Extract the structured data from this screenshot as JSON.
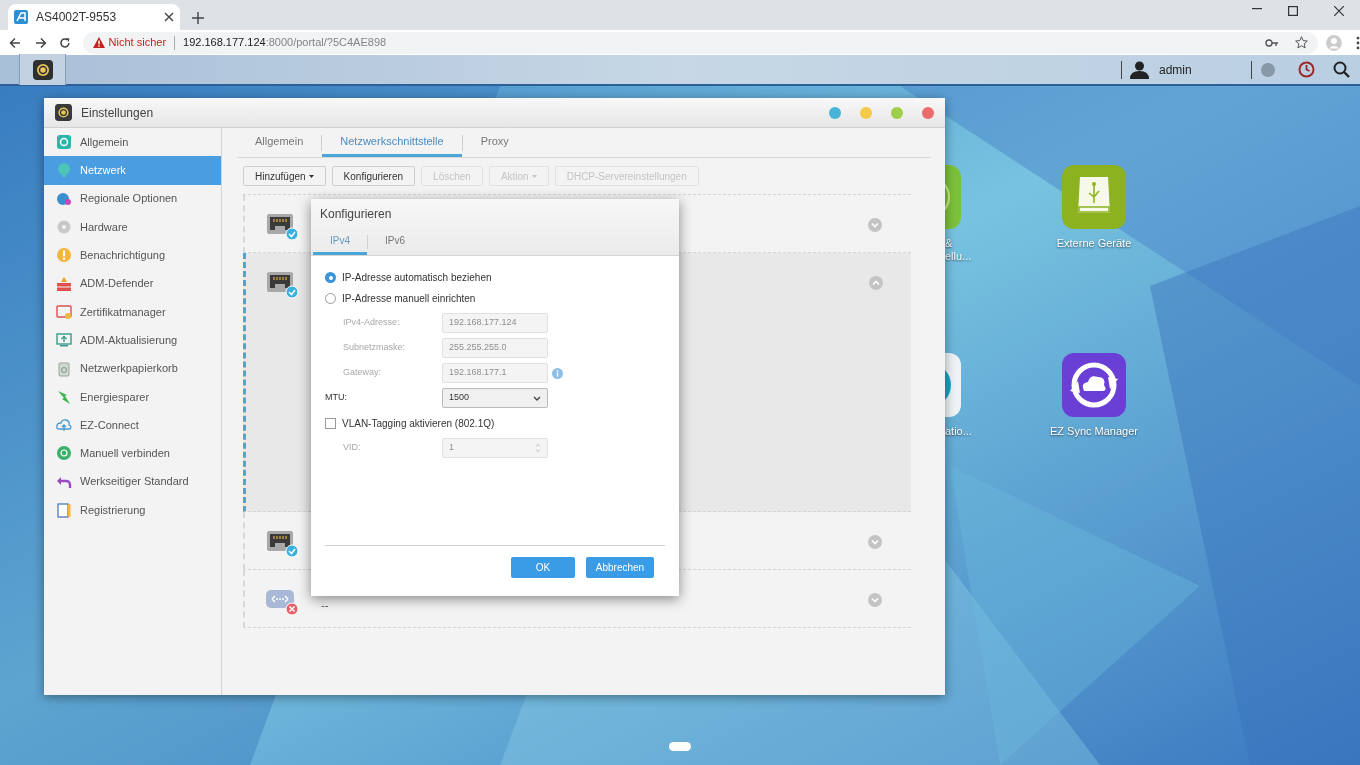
{
  "browser": {
    "tab_title": "AS4002T-9553",
    "security": "Nicht sicher",
    "url_host": "192.168.177.124",
    "url_rest": ":8000/portal/?5C4AE898"
  },
  "taskbar": {
    "user": "admin"
  },
  "desktop_icons": [
    {
      "kind": "cut-ring",
      "labels": [
        "&",
        "ellu..."
      ]
    },
    {
      "kind": "cut-disc",
      "labels": [
        "atio..."
      ]
    },
    {
      "kind": "usb-drive",
      "labels": [
        "Externe Geräte"
      ]
    },
    {
      "kind": "sync",
      "labels": [
        "EZ Sync Manager"
      ]
    }
  ],
  "window": {
    "title": "Einstellungen",
    "sidebar": [
      {
        "label": "Allgemein",
        "selected": false
      },
      {
        "label": "Netzwerk",
        "selected": true
      },
      {
        "label": "Regionale Optionen",
        "selected": false
      },
      {
        "label": "Hardware",
        "selected": false
      },
      {
        "label": "Benachrichtigung",
        "selected": false
      },
      {
        "label": "ADM-Defender",
        "selected": false
      },
      {
        "label": "Zertifikatmanager",
        "selected": false
      },
      {
        "label": "ADM-Aktualisierung",
        "selected": false
      },
      {
        "label": "Netzwerkpapierkorb",
        "selected": false
      },
      {
        "label": "Energiesparer",
        "selected": false
      },
      {
        "label": "EZ-Connect",
        "selected": false
      },
      {
        "label": "Manuell verbinden",
        "selected": false
      },
      {
        "label": "Werkseitiger Standard",
        "selected": false
      },
      {
        "label": "Registrierung",
        "selected": false
      }
    ],
    "tabs": [
      {
        "label": "Allgemein",
        "selected": false
      },
      {
        "label": "Netzwerkschnittstelle",
        "selected": true
      },
      {
        "label": "Proxy",
        "selected": false
      }
    ],
    "toolbar": [
      {
        "label": "Hinzufügen",
        "dropdown": true,
        "disabled": false
      },
      {
        "label": "Konfigurieren",
        "dropdown": false,
        "disabled": false
      },
      {
        "label": "Löschen",
        "dropdown": false,
        "disabled": true
      },
      {
        "label": "Aktion",
        "dropdown": true,
        "disabled": true
      },
      {
        "label": "DHCP-Servereinstellungen",
        "dropdown": false,
        "disabled": true
      }
    ],
    "interfaces": [
      {
        "kind": "ethernet",
        "connected": true,
        "expanded": false
      },
      {
        "kind": "ethernet",
        "connected": true,
        "expanded": true
      },
      {
        "kind": "ethernet",
        "connected": true,
        "expanded": false
      },
      {
        "kind": "virtual",
        "connected": false,
        "expanded": false,
        "name": "--"
      }
    ]
  },
  "dialog": {
    "title": "Konfigurieren",
    "tabs": [
      {
        "label": "IPv4",
        "selected": true
      },
      {
        "label": "IPv6",
        "selected": false
      }
    ],
    "options": [
      {
        "label": "IP-Adresse automatisch beziehen",
        "selected": true
      },
      {
        "label": "IP-Adresse manuell einrichten",
        "selected": false
      }
    ],
    "fields": [
      {
        "label": "IPv4-Adresse:",
        "value": "192.168.177.124",
        "disabled": true,
        "info": false
      },
      {
        "label": "Subnetzmaske:",
        "value": "255.255.255.0",
        "disabled": true,
        "info": false
      },
      {
        "label": "Gateway:",
        "value": "192.168.177.1",
        "disabled": true,
        "info": true
      }
    ],
    "mtu": {
      "label": "MTU:",
      "value": "1500"
    },
    "vlan": {
      "label": "VLAN-Tagging aktivieren (802.1Q)",
      "checked": false
    },
    "vid": {
      "label": "VID:",
      "value": "1",
      "disabled": true
    },
    "buttons": [
      "OK",
      "Abbrechen"
    ]
  }
}
